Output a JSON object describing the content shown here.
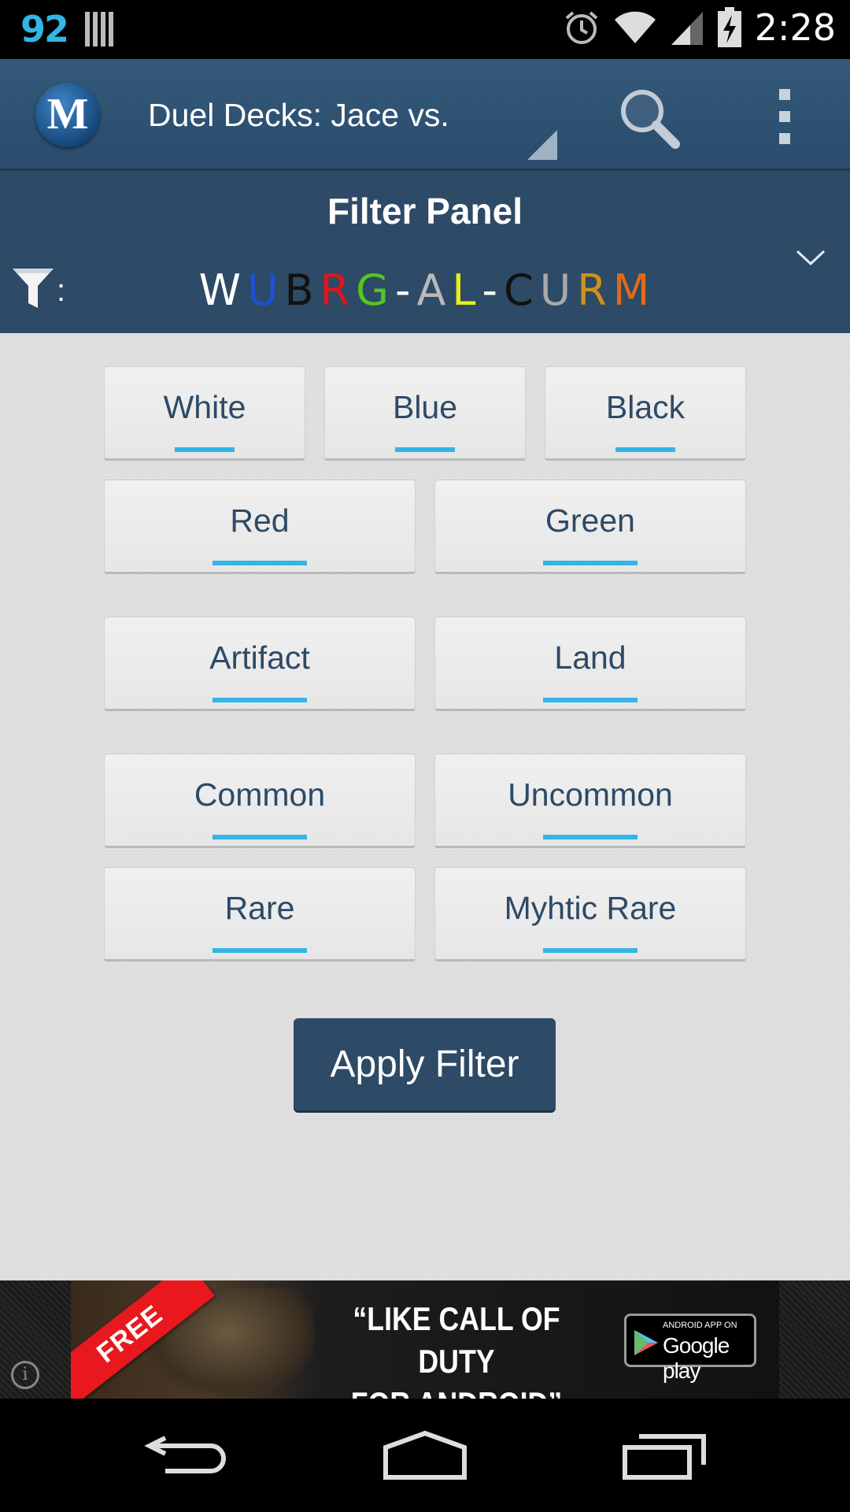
{
  "status_bar": {
    "notification_count": "92",
    "time": "2:28",
    "icons": [
      "barcode-icon",
      "alarm-icon",
      "wifi-icon",
      "signal-icon",
      "battery-charging-icon"
    ]
  },
  "action_bar": {
    "logo_letter": "M",
    "set_title": "Duel Decks: Jace vs.",
    "icons": [
      "search-icon",
      "overflow-menu-icon"
    ]
  },
  "filter_panel": {
    "title": "Filter Panel",
    "colon": ":",
    "summary": [
      {
        "text": "W",
        "color": "#ffffff"
      },
      {
        "text": "U",
        "color": "#1f4fd6"
      },
      {
        "text": "B",
        "color": "#111111"
      },
      {
        "text": "R",
        "color": "#e0141e"
      },
      {
        "text": "G",
        "color": "#55c61e"
      },
      {
        "text": "-",
        "color": "#ffffff"
      },
      {
        "text": "A",
        "color": "#b9b9b9"
      },
      {
        "text": "L",
        "color": "#e7ef1a"
      },
      {
        "text": "-",
        "color": "#ffffff"
      },
      {
        "text": "C",
        "color": "#111111"
      },
      {
        "text": "U",
        "color": "#a9a9a9"
      },
      {
        "text": "R",
        "color": "#d0911c"
      },
      {
        "text": "M",
        "color": "#e06a1a"
      }
    ]
  },
  "toggles": {
    "white": "White",
    "blue": "Blue",
    "black": "Black",
    "red": "Red",
    "green": "Green",
    "artifact": "Artifact",
    "land": "Land",
    "common": "Common",
    "uncommon": "Uncommon",
    "rare": "Rare",
    "mythic_rare": "Myhtic Rare"
  },
  "apply_button": "Apply Filter",
  "ad": {
    "ribbon": "FREE",
    "headline_line1": "“LIKE CALL OF DUTY",
    "headline_line2": "FOR ANDROID”",
    "store_small": "ANDROID APP ON",
    "store_big": "Google play",
    "info_glyph": "i"
  },
  "colors": {
    "accent": "#33b5e5",
    "primary": "#2d4a66",
    "panel_bg": "#e0e0e0"
  }
}
